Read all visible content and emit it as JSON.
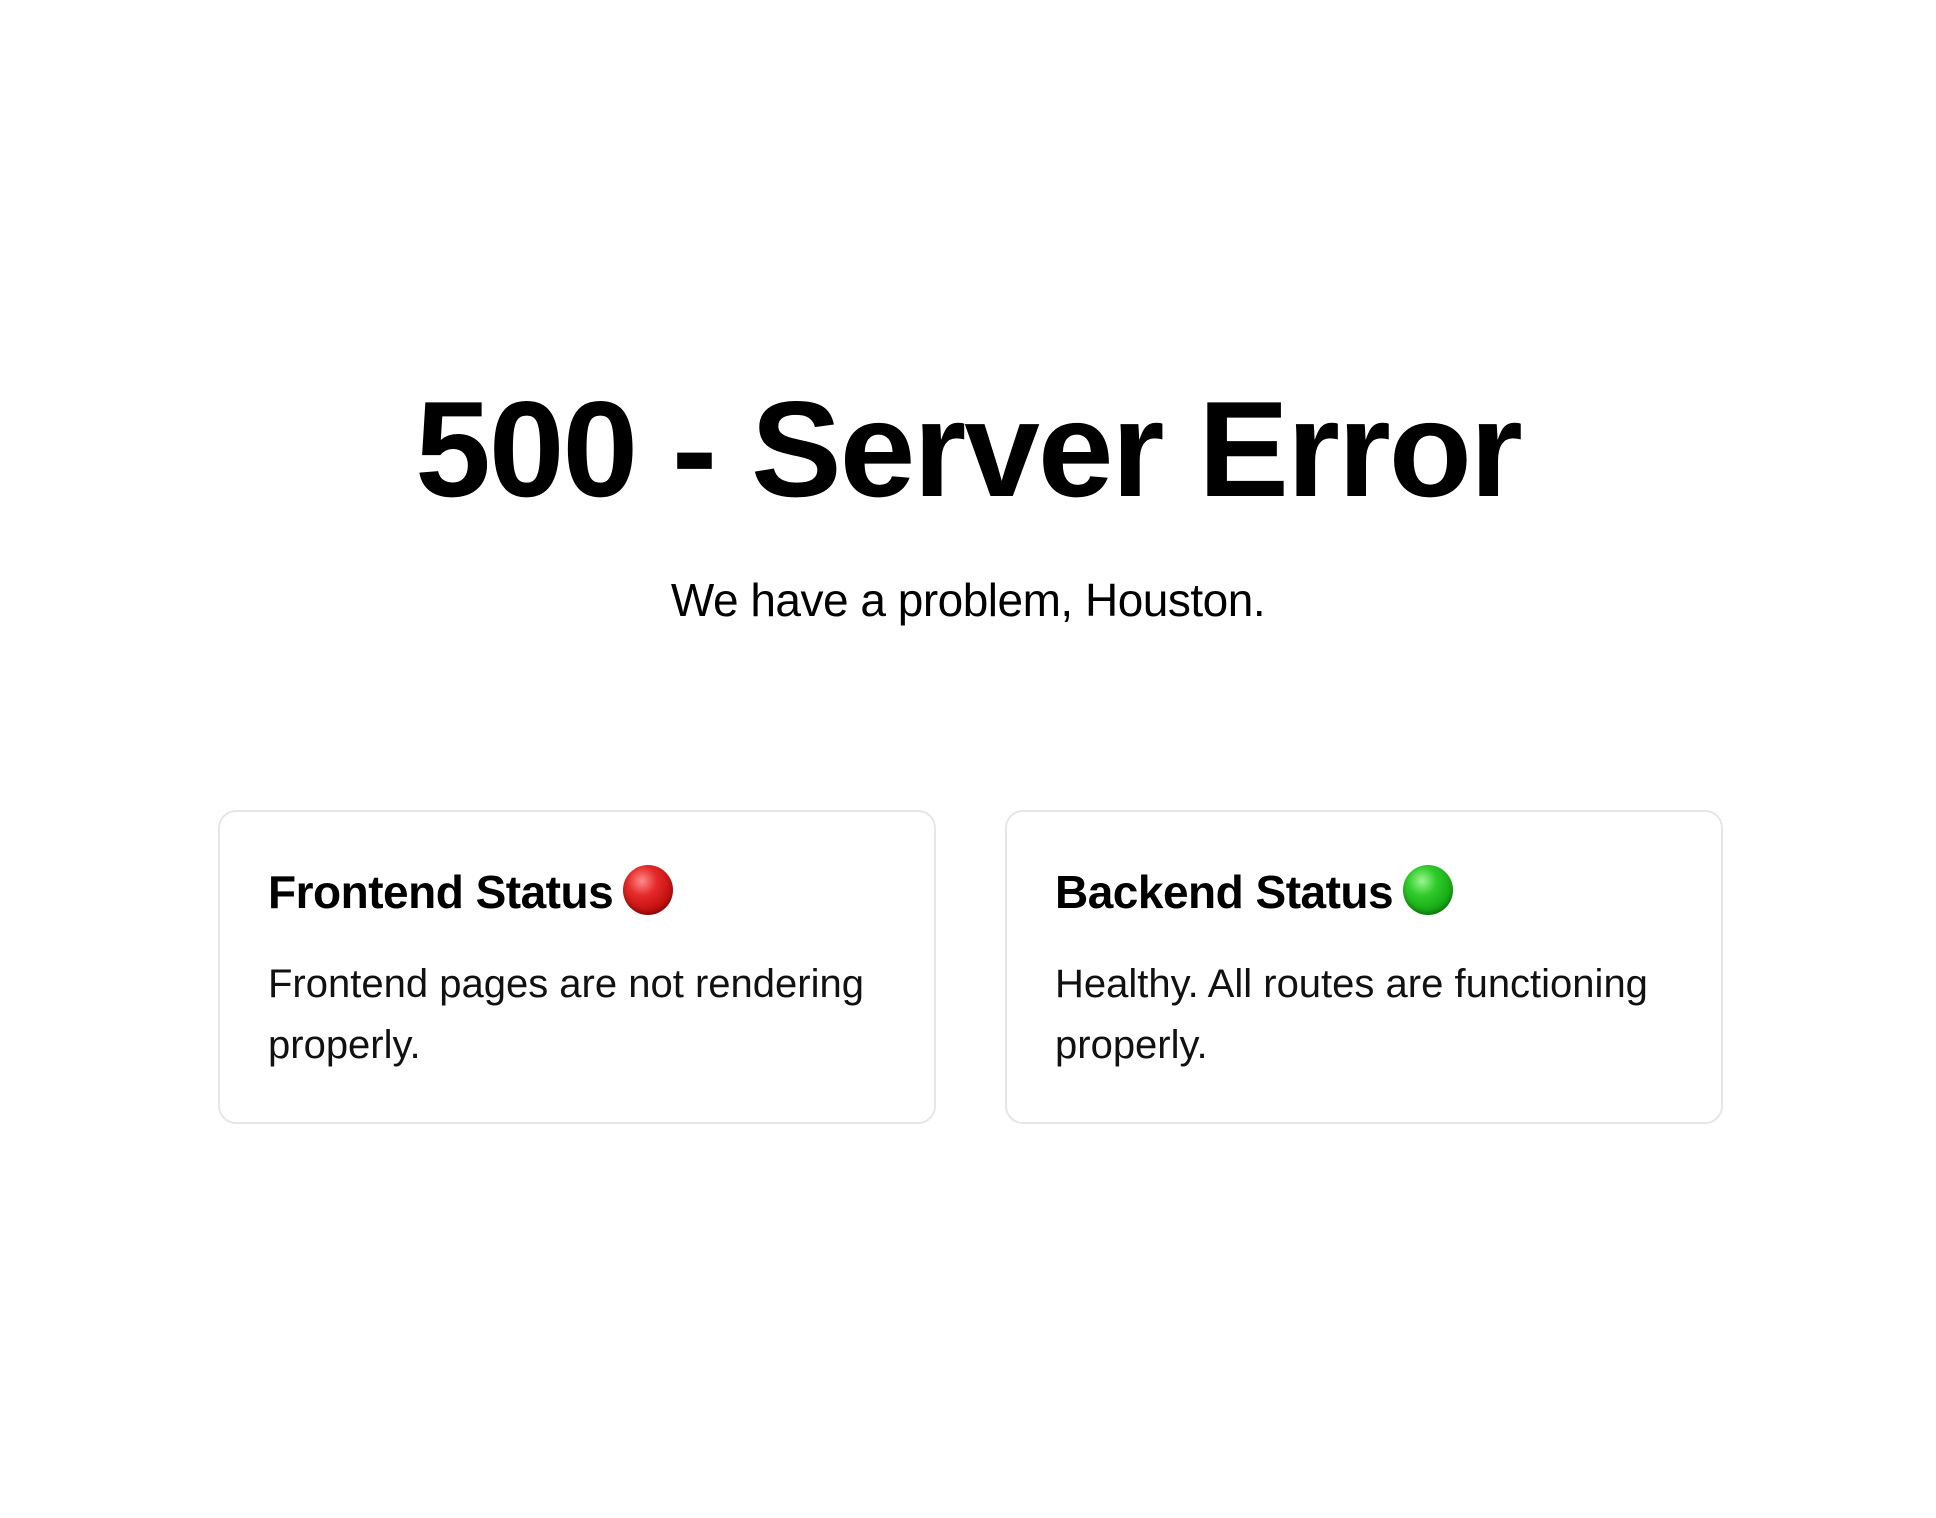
{
  "header": {
    "title": "500 - Server Error",
    "subtitle": "We have a problem, Houston."
  },
  "cards": [
    {
      "title": "Frontend Status",
      "status_icon": "red-circle-icon",
      "status_color": "#d61a1a",
      "message": "Frontend pages are not rendering properly."
    },
    {
      "title": "Backend Status",
      "status_icon": "green-circle-icon",
      "status_color": "#22b61f",
      "message": "Healthy. All routes are functioning properly."
    }
  ]
}
